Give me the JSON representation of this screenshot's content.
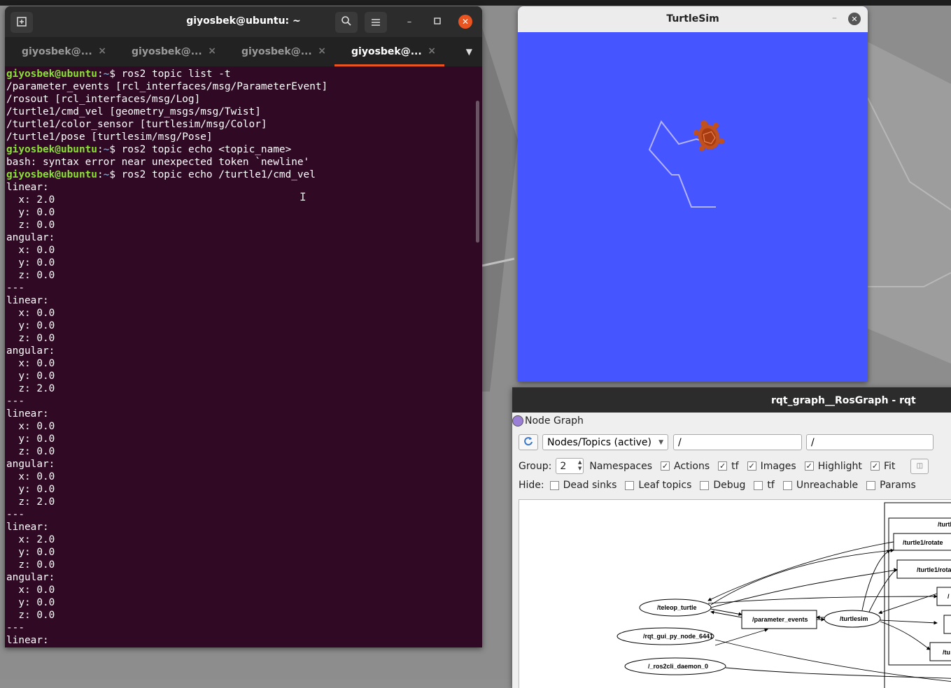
{
  "terminal": {
    "title": "giyosbek@ubuntu: ~",
    "tabs": [
      "giyosbek@...",
      "giyosbek@...",
      "giyosbek@...",
      "giyosbek@..."
    ],
    "active_tab": 3,
    "lines": [
      {
        "t": "prompt",
        "user": "giyosbek@ubuntu",
        "path": "~",
        "cmd": "ros2 topic list -t"
      },
      {
        "t": "out",
        "text": "/parameter_events [rcl_interfaces/msg/ParameterEvent]"
      },
      {
        "t": "out",
        "text": "/rosout [rcl_interfaces/msg/Log]"
      },
      {
        "t": "out",
        "text": "/turtle1/cmd_vel [geometry_msgs/msg/Twist]"
      },
      {
        "t": "out",
        "text": "/turtle1/color_sensor [turtlesim/msg/Color]"
      },
      {
        "t": "out",
        "text": "/turtle1/pose [turtlesim/msg/Pose]"
      },
      {
        "t": "prompt",
        "user": "giyosbek@ubuntu",
        "path": "~",
        "cmd": "ros2 topic echo <topic_name>"
      },
      {
        "t": "out",
        "text": "bash: syntax error near unexpected token `newline'"
      },
      {
        "t": "prompt",
        "user": "giyosbek@ubuntu",
        "path": "~",
        "cmd": "ros2 topic echo /turtle1/cmd_vel"
      },
      {
        "t": "out",
        "text": "linear:"
      },
      {
        "t": "out",
        "text": "  x: 2.0"
      },
      {
        "t": "out",
        "text": "  y: 0.0"
      },
      {
        "t": "out",
        "text": "  z: 0.0"
      },
      {
        "t": "out",
        "text": "angular:"
      },
      {
        "t": "out",
        "text": "  x: 0.0"
      },
      {
        "t": "out",
        "text": "  y: 0.0"
      },
      {
        "t": "out",
        "text": "  z: 0.0"
      },
      {
        "t": "out",
        "text": "---"
      },
      {
        "t": "out",
        "text": "linear:"
      },
      {
        "t": "out",
        "text": "  x: 0.0"
      },
      {
        "t": "out",
        "text": "  y: 0.0"
      },
      {
        "t": "out",
        "text": "  z: 0.0"
      },
      {
        "t": "out",
        "text": "angular:"
      },
      {
        "t": "out",
        "text": "  x: 0.0"
      },
      {
        "t": "out",
        "text": "  y: 0.0"
      },
      {
        "t": "out",
        "text": "  z: 2.0"
      },
      {
        "t": "out",
        "text": "---"
      },
      {
        "t": "out",
        "text": "linear:"
      },
      {
        "t": "out",
        "text": "  x: 0.0"
      },
      {
        "t": "out",
        "text": "  y: 0.0"
      },
      {
        "t": "out",
        "text": "  z: 0.0"
      },
      {
        "t": "out",
        "text": "angular:"
      },
      {
        "t": "out",
        "text": "  x: 0.0"
      },
      {
        "t": "out",
        "text": "  y: 0.0"
      },
      {
        "t": "out",
        "text": "  z: 2.0"
      },
      {
        "t": "out",
        "text": "---"
      },
      {
        "t": "out",
        "text": "linear:"
      },
      {
        "t": "out",
        "text": "  x: 2.0"
      },
      {
        "t": "out",
        "text": "  y: 0.0"
      },
      {
        "t": "out",
        "text": "  z: 0.0"
      },
      {
        "t": "out",
        "text": "angular:"
      },
      {
        "t": "out",
        "text": "  x: 0.0"
      },
      {
        "t": "out",
        "text": "  y: 0.0"
      },
      {
        "t": "out",
        "text": "  z: 0.0"
      },
      {
        "t": "out",
        "text": "---"
      },
      {
        "t": "out",
        "text": "linear:"
      }
    ]
  },
  "turtlesim": {
    "title": "TurtleSim",
    "background_color": "#4555ff",
    "trail_color": "#b3b3ff"
  },
  "rqt": {
    "title": "rqt_graph__RosGraph - rqt",
    "panel_title": "Node Graph",
    "mode_select": "Nodes/Topics (active)",
    "filter_1": "/",
    "filter_2": "/",
    "group_label": "Group:",
    "group_value": "2",
    "row1": [
      {
        "label": "Namespaces",
        "checked": null
      },
      {
        "label": "Actions",
        "checked": true
      },
      {
        "label": "tf",
        "checked": true
      },
      {
        "label": "Images",
        "checked": true
      },
      {
        "label": "Highlight",
        "checked": true
      },
      {
        "label": "Fit",
        "checked": true
      }
    ],
    "hide_label": "Hide:",
    "row2": [
      {
        "label": "Dead sinks",
        "checked": false
      },
      {
        "label": "Leaf topics",
        "checked": false
      },
      {
        "label": "Debug",
        "checked": false
      },
      {
        "label": "tf",
        "checked": false
      },
      {
        "label": "Unreachable",
        "checked": false
      },
      {
        "label": "Params",
        "checked": false
      }
    ],
    "graph_nodes": {
      "teleop": "/teleop_turtle",
      "gui": "/rqt_gui_py_node_6441",
      "daemon": "/_ros2cli_daemon_0",
      "param_events": "/parameter_events",
      "turtlesim": "/turtlesim",
      "group_label": "/turtl",
      "rotate1": "/turtle1/rotate",
      "rotate2": "/turtle1/rota",
      "t3": "/",
      "t4": "/tu"
    }
  }
}
